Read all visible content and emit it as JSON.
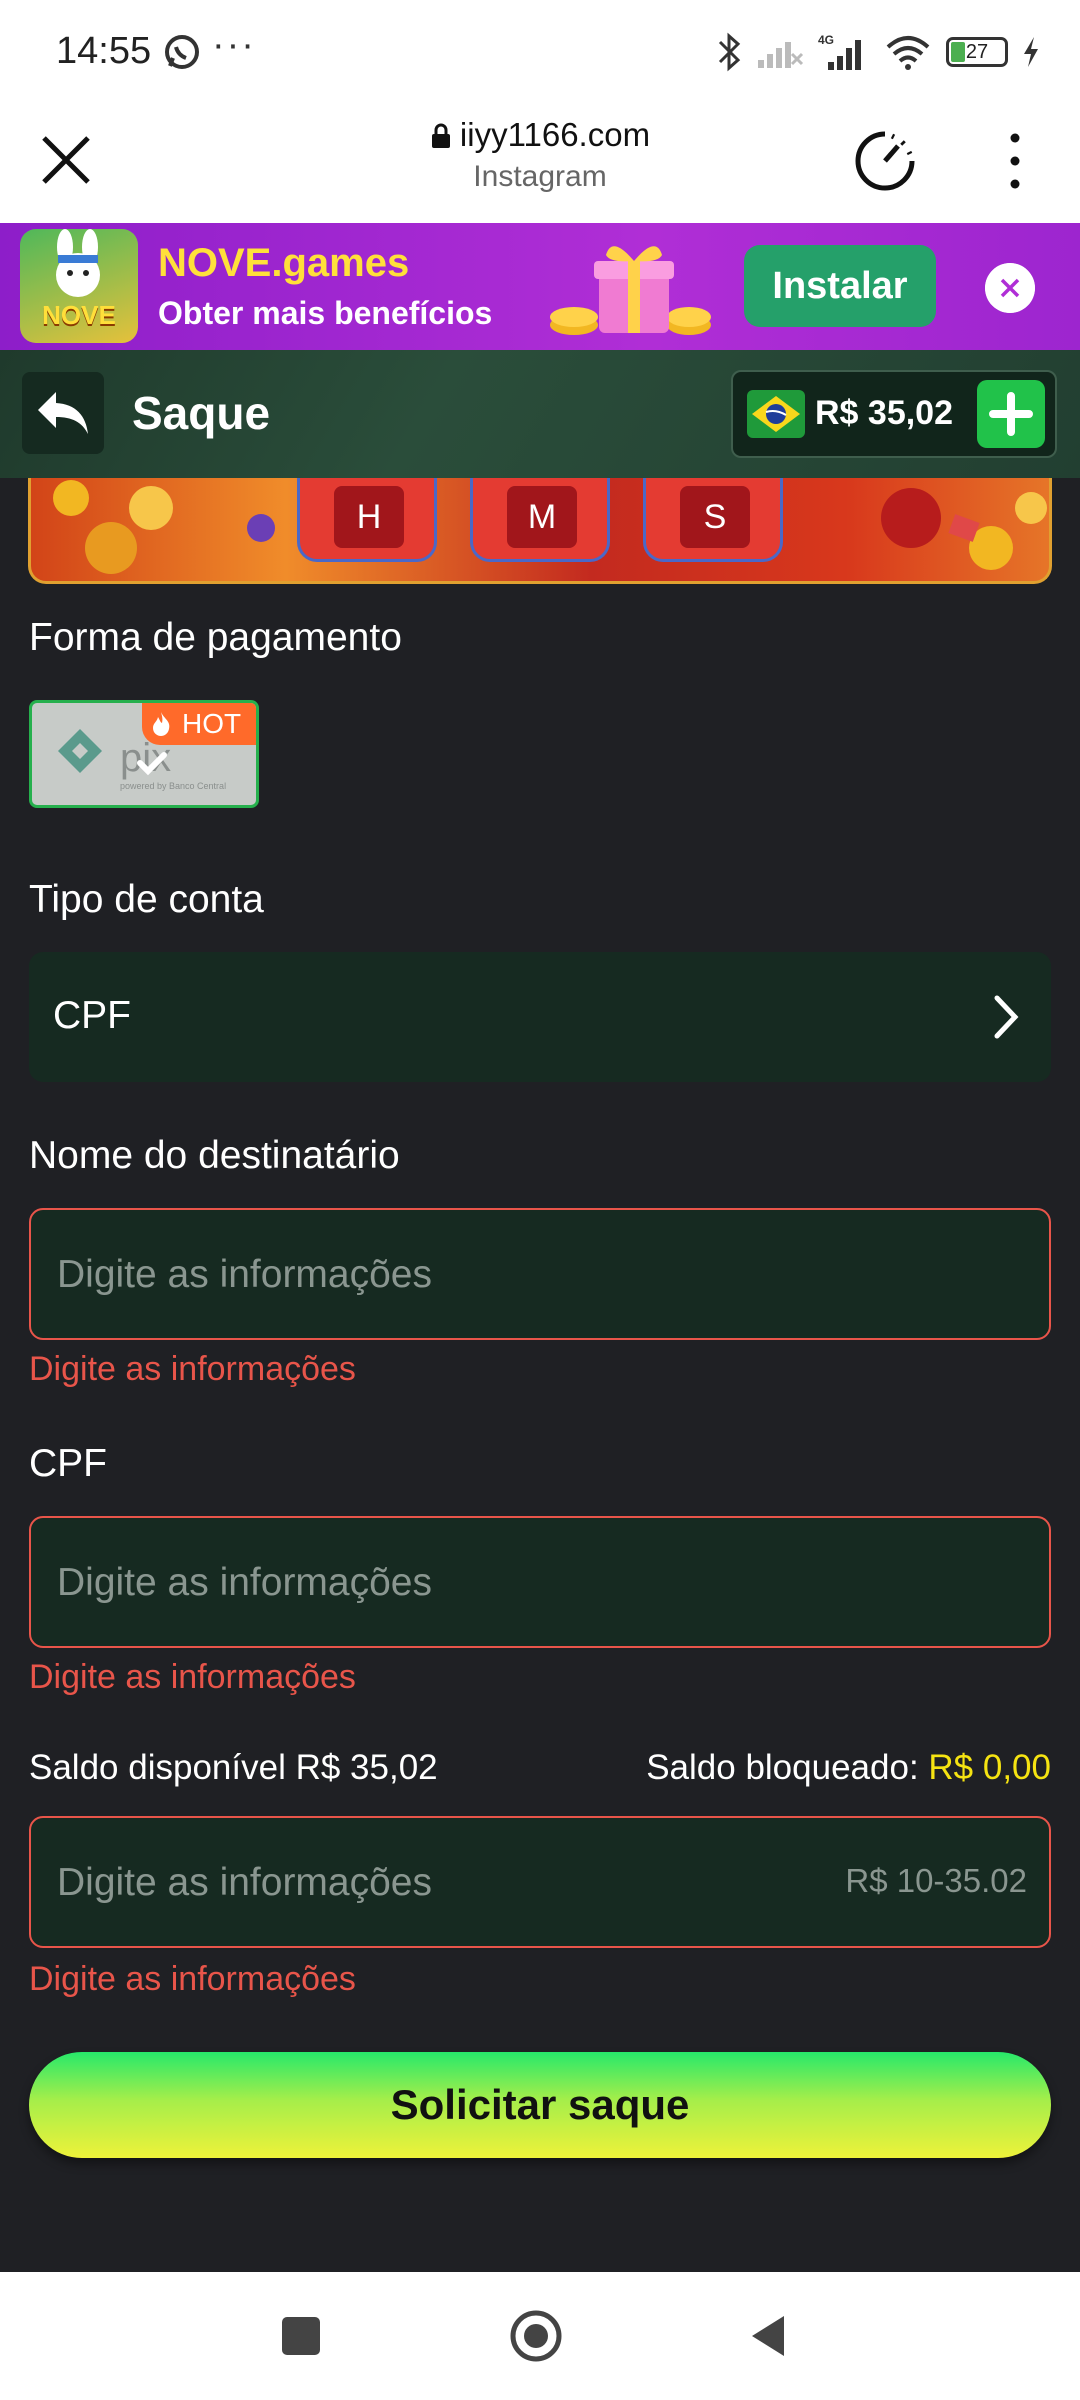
{
  "status_bar": {
    "time": "14:55",
    "dots": "···",
    "battery": "27",
    "icons": [
      "whatsapp-icon",
      "bluetooth-icon",
      "signal-off-icon",
      "4g-signal-icon",
      "wifi-icon",
      "battery-icon",
      "charging-icon"
    ]
  },
  "browser": {
    "url": "iiyy1166.com",
    "subtitle": "Instagram"
  },
  "ad_banner": {
    "logo_text": "NOVE",
    "title": "NOVE.games",
    "subtitle": "Obter mais benefícios",
    "install_label": "Instalar"
  },
  "header": {
    "title": "Saque",
    "balance": "R$ 35,02"
  },
  "time_boxes": [
    "H",
    "M",
    "S"
  ],
  "payment": {
    "label": "Forma de pagamento",
    "method": "PIX",
    "badge": "HOT"
  },
  "account_type": {
    "label": "Tipo de conta",
    "value": "CPF"
  },
  "recipient": {
    "label": "Nome do destinatário",
    "placeholder": "Digite as informações",
    "error": "Digite as informações"
  },
  "cpf": {
    "label": "CPF",
    "placeholder": "Digite as informações",
    "error": "Digite as informações"
  },
  "saldo": {
    "available_label": "Saldo disponível",
    "available_value": "R$ 35,02",
    "blocked_label": "Saldo bloqueado:",
    "blocked_value": "R$ 0,00"
  },
  "amount": {
    "placeholder": "Digite as informações",
    "range": "R$ 10-35.02",
    "error": "Digite as informações"
  },
  "submit_label": "Solicitar saque",
  "colors": {
    "background": "#1f2024",
    "field_bg": "#162a21",
    "error": "#e8554a",
    "accent_green": "#21c24a",
    "blocked_yellow": "#f5e312"
  }
}
